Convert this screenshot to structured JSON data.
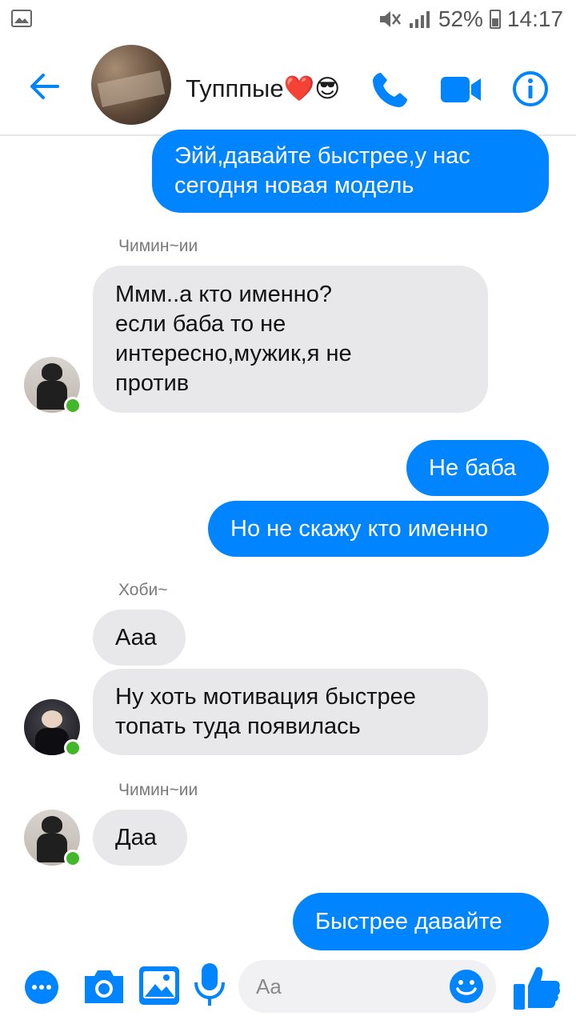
{
  "status_bar": {
    "battery": "52%",
    "time": "14:17"
  },
  "header": {
    "title": "Тупппые❤️😎",
    "icons": [
      "back-arrow-icon",
      "phone-icon",
      "video-camera-icon",
      "info-icon"
    ]
  },
  "messages": [
    {
      "direction": "outgoing",
      "text": "Эйй,давайте быстрее,у нас\nсегодня новая модель"
    },
    {
      "direction": "incoming",
      "sender": "Чимин~ии",
      "text": "Ммм..а кто именно?\nесли баба то не\nинтересно,мужик,я не\nпротив"
    },
    {
      "direction": "outgoing",
      "text": "Не баба"
    },
    {
      "direction": "outgoing",
      "text": "Но не скажу кто именно"
    },
    {
      "direction": "incoming",
      "sender": "Хоби~",
      "text": "Ааа"
    },
    {
      "direction": "incoming",
      "text": "Ну хоть мотивация быстрее\nтопать туда появилась"
    },
    {
      "direction": "incoming",
      "sender": "Чимин~ии",
      "text": "Даа"
    },
    {
      "direction": "outgoing",
      "text": "Быстрее давайте"
    }
  ],
  "composer": {
    "placeholder": "Aa",
    "icons": [
      "more-icon",
      "camera-icon",
      "gallery-icon",
      "microphone-icon",
      "emoji-icon",
      "like-thumb-icon"
    ]
  },
  "colors": {
    "accent": "#0084ff",
    "incoming_bubble": "#e8e8ea",
    "online": "#42b72a"
  }
}
